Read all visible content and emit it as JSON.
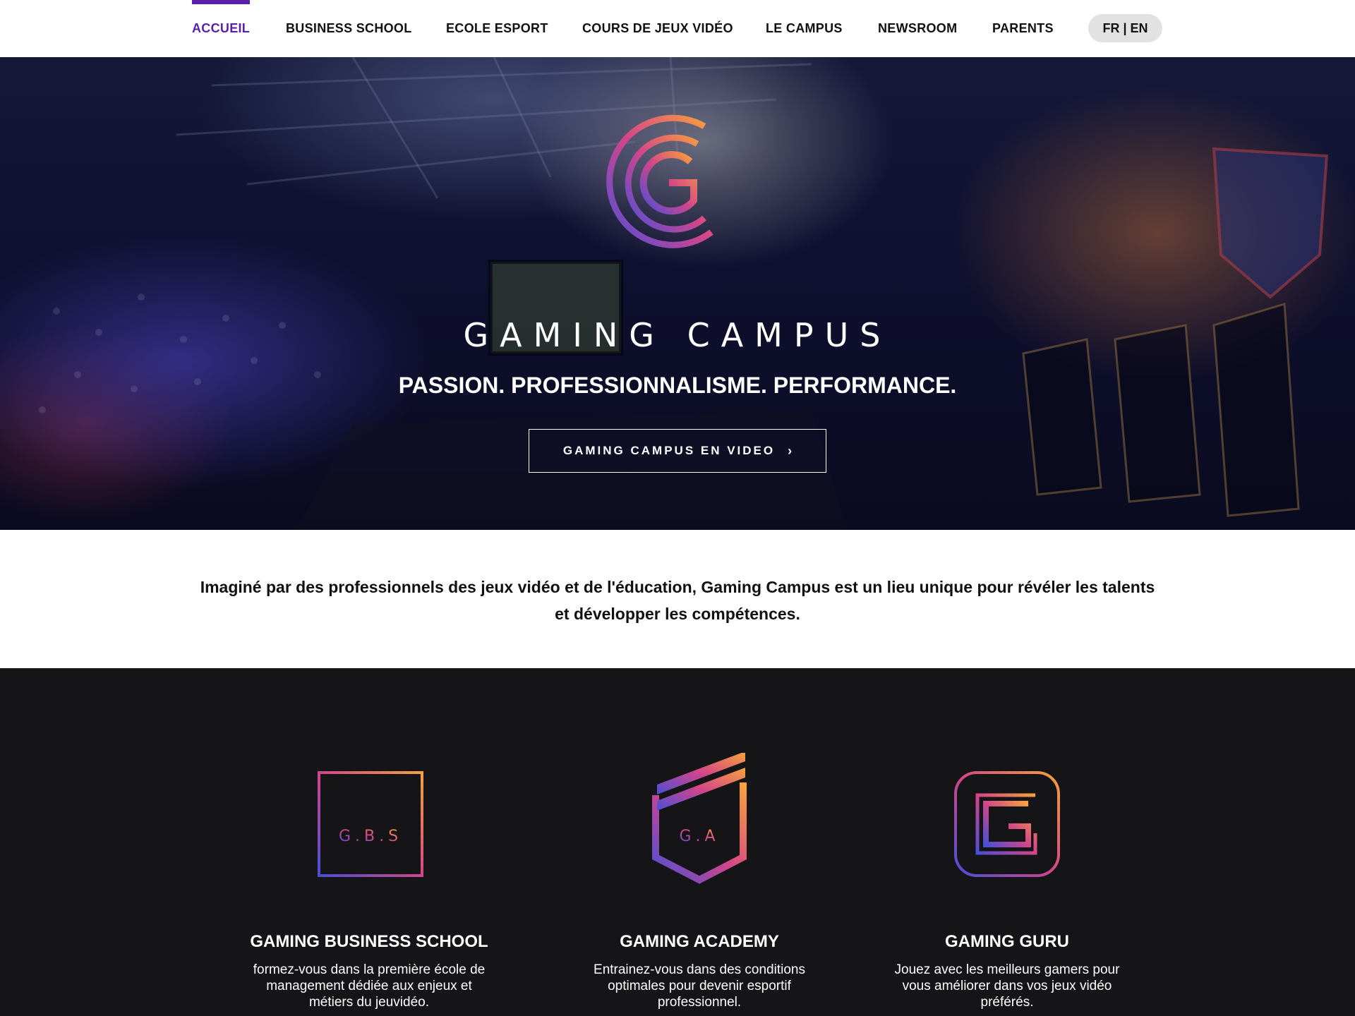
{
  "nav": {
    "items": [
      {
        "label": "ACCUEIL",
        "active": true
      },
      {
        "label": "BUSINESS SCHOOL",
        "active": false
      },
      {
        "label": "ECOLE ESPORT",
        "active": false
      },
      {
        "label": "COURS DE JEUX VIDÉO",
        "active": false
      },
      {
        "label": "LE CAMPUS",
        "active": false
      },
      {
        "label": "NEWSROOM",
        "active": false
      },
      {
        "label": "PARENTS",
        "active": false
      }
    ],
    "language": "FR | EN"
  },
  "hero": {
    "logo_icon": "gaming-campus-g-logo",
    "brand": "GAMING CAMPUS",
    "tagline": "PASSION. PROFESSIONNALISME. PERFORMANCE.",
    "video_button": "GAMING CAMPUS EN VIDEO",
    "video_button_icon": "chevron-right-icon"
  },
  "intro": {
    "text": "Imaginé par des professionnels des jeux vidéo et de l'éducation, Gaming Campus est un lieu unique pour révéler les talents et développer les compétences."
  },
  "cards": [
    {
      "icon": "gbs-square-logo",
      "icon_text": "G.B.S",
      "title": "GAMING BUSINESS SCHOOL",
      "text": "formez-vous dans la première école de management dédiée aux enjeux et métiers du jeuvidéo."
    },
    {
      "icon": "ga-shield-logo",
      "icon_text": "G.A",
      "title": "GAMING ACADEMY",
      "text": "Entrainez-vous dans des conditions optimales pour devenir esportif professionnel."
    },
    {
      "icon": "gg-rounded-logo",
      "title": "GAMING GURU",
      "text": "Jouez avec les meilleurs gamers pour vous améliorer dans vos jeux vidéo préférés."
    }
  ],
  "colors": {
    "accent": "#5b1fa8",
    "gradient_start": "#f7a23b",
    "gradient_mid": "#d4458a",
    "gradient_end": "#4a4fd8",
    "dark_bg": "#151416"
  }
}
